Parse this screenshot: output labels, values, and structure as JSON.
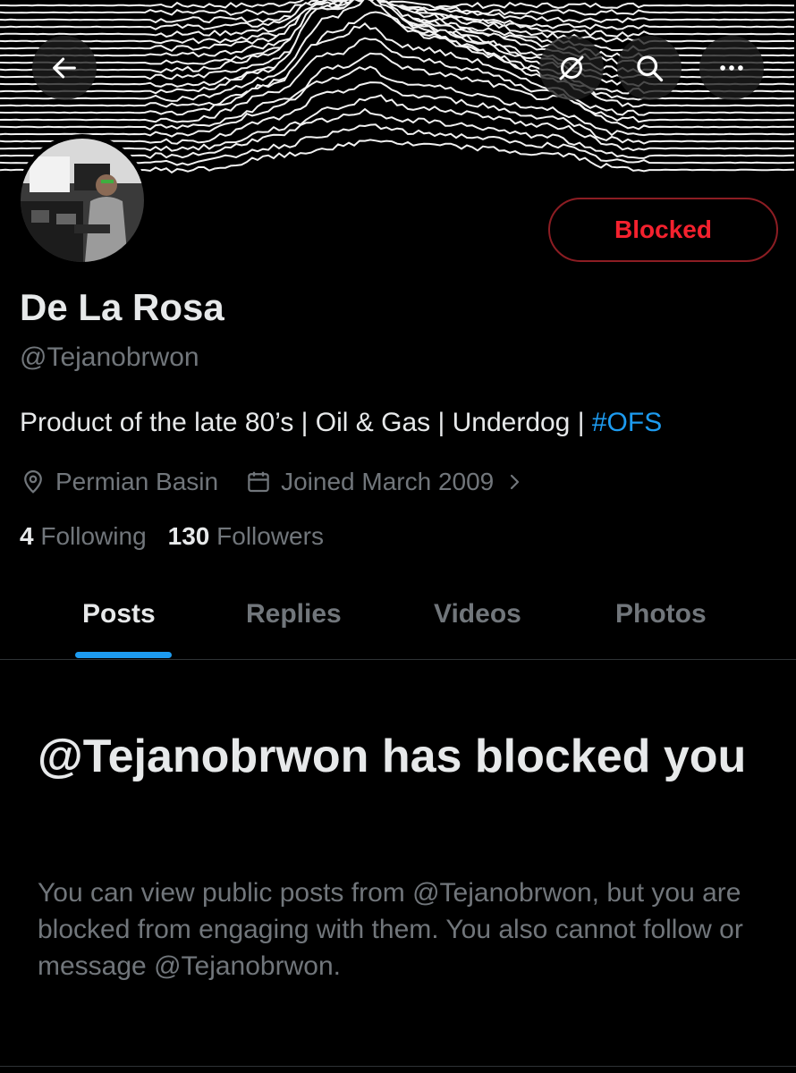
{
  "profile": {
    "name": "De La Rosa",
    "handle": "@Tejanobrwon",
    "bio_text": "Product of the late 80’s | Oil & Gas | Underdog | ",
    "bio_hashtag": "#OFS",
    "location": "Permian Basin",
    "joined": "Joined March 2009",
    "following_count": "4",
    "following_label": "Following",
    "followers_count": "130",
    "followers_label": "Followers"
  },
  "header": {
    "back_icon": "arrow-left-icon",
    "grok_icon": "grok-icon",
    "search_icon": "search-icon",
    "more_icon": "more-dots-icon"
  },
  "actions": {
    "blocked_label": "Blocked"
  },
  "tabs": [
    {
      "label": "Posts",
      "active": true
    },
    {
      "label": "Replies",
      "active": false
    },
    {
      "label": "Videos",
      "active": false
    },
    {
      "label": "Photos",
      "active": false
    }
  ],
  "block_notice": {
    "title": "@Tejanobrwon has blocked you",
    "description": "You can view public posts from @Tejanobrwon, but you are blocked from engaging with them. You also cannot follow or message @Tejanobrwon."
  },
  "colors": {
    "background": "#000000",
    "text_primary": "#e7e9ea",
    "text_secondary": "#71767b",
    "accent": "#1d9bf0",
    "blocked_red": "#f4212e"
  }
}
